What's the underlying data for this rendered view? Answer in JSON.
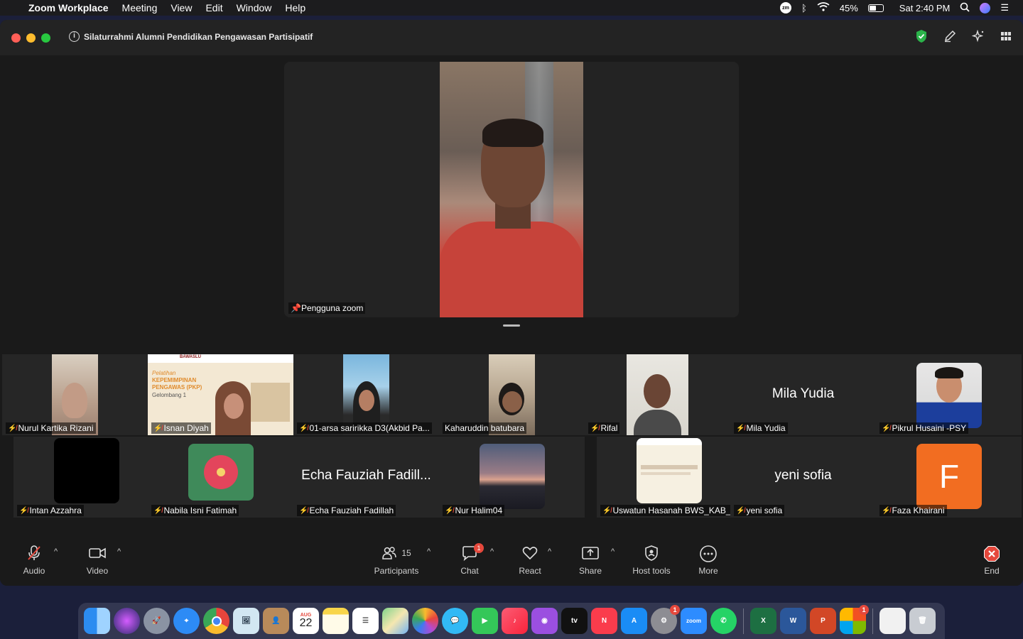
{
  "menubar": {
    "app_name": "Zoom Workplace",
    "items": [
      "Meeting",
      "View",
      "Edit",
      "Window",
      "Help"
    ],
    "battery_percent": "45%",
    "battery_level": 0.45,
    "clock": "Sat 2:40 PM"
  },
  "window": {
    "title": "Silaturrahmi  Alumni Pendidikan Pengawasan Partisipatif"
  },
  "stage": {
    "pinned_name": "Pengguna zoom"
  },
  "participants": [
    {
      "name": "Nurul Kartika Rizani"
    },
    {
      "name": "Isnan Diyah",
      "share_lines": [
        "Pelatihan",
        "KEPEMIMPINAN",
        "PENGAWAS (PKP)",
        "Gelombang 1"
      ],
      "share_header": "BAWASLU"
    },
    {
      "name": "01-arsa saririkka D3(Akbid Pa..."
    },
    {
      "name": "Kaharuddin batubara"
    },
    {
      "name": "Rifal"
    },
    {
      "name": "Mila Yudia",
      "display": "Mila Yudia"
    },
    {
      "name": "Pikrul Husaini -PSY"
    },
    {
      "name": "Intan Azzahra"
    },
    {
      "name": "Nabila Isni Fatimah"
    },
    {
      "name": "Echa Fauziah Fadillah",
      "display": "Echa Fauziah Fadill..."
    },
    {
      "name": "Nur Halim04"
    },
    {
      "name": "Uswatun Hasanah BWS_KAB_..."
    },
    {
      "name": "yeni sofia",
      "display": "yeni sofia"
    },
    {
      "name": "Faza Khairani",
      "avatar_letter": "F"
    }
  ],
  "toolbar": {
    "audio": "Audio",
    "video": "Video",
    "participants": "Participants",
    "participants_count": "15",
    "chat": "Chat",
    "chat_badge": "1",
    "react": "React",
    "share": "Share",
    "host_tools": "Host tools",
    "more": "More",
    "end": "End"
  },
  "dock": {
    "calendar_month": "AUG",
    "calendar_day": "22",
    "zoom_label": "zoom",
    "tv_label": "tv",
    "settings_badge": "1",
    "office_badge": "1"
  },
  "colors": {
    "end_red": "#e5483c",
    "shield_green": "#2bb34a",
    "avatar_orange": "#f26d21"
  }
}
